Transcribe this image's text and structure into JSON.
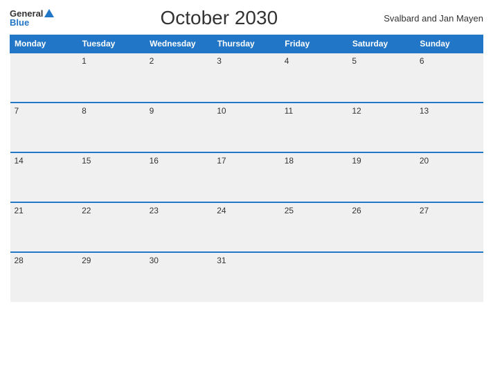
{
  "header": {
    "logo_general": "General",
    "logo_blue": "Blue",
    "title": "October 2030",
    "region": "Svalbard and Jan Mayen"
  },
  "weekdays": [
    "Monday",
    "Tuesday",
    "Wednesday",
    "Thursday",
    "Friday",
    "Saturday",
    "Sunday"
  ],
  "weeks": [
    [
      "",
      "1",
      "2",
      "3",
      "4",
      "5",
      "6"
    ],
    [
      "7",
      "8",
      "9",
      "10",
      "11",
      "12",
      "13"
    ],
    [
      "14",
      "15",
      "16",
      "17",
      "18",
      "19",
      "20"
    ],
    [
      "21",
      "22",
      "23",
      "24",
      "25",
      "26",
      "27"
    ],
    [
      "28",
      "29",
      "30",
      "31",
      "",
      "",
      ""
    ]
  ]
}
